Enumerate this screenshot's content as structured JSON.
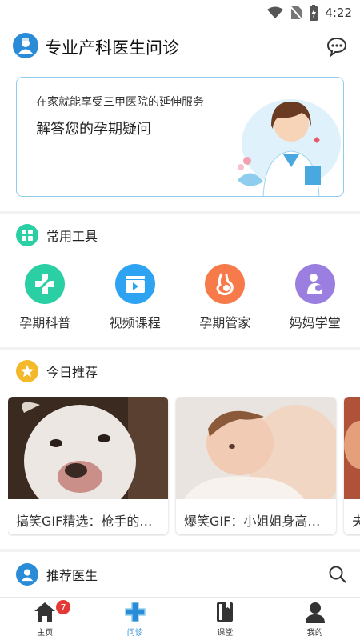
{
  "status_bar": {
    "time": "4:22"
  },
  "header": {
    "title": "专业产科医生问诊"
  },
  "banner": {
    "subtitle": "在家就能享受三甲医院的延伸服务",
    "headline": "解答您的孕期疑问"
  },
  "tools": {
    "section_title": "常用工具",
    "items": [
      {
        "label": "孕期科普",
        "icon": "cross-plus-icon",
        "color": "#2bcfa4"
      },
      {
        "label": "视频课程",
        "icon": "video-clapper-icon",
        "color": "#2ea3f2"
      },
      {
        "label": "孕期管家",
        "icon": "pregnant-belly-icon",
        "color": "#f77b4a"
      },
      {
        "label": "妈妈学堂",
        "icon": "mother-baby-icon",
        "color": "#9b7fe0"
      }
    ]
  },
  "recommend": {
    "section_title": "今日推荐",
    "cards": [
      {
        "title": "搞笑GIF精选：枪手的…"
      },
      {
        "title": "爆笑GIF：小姐姐身高…"
      },
      {
        "title": "夫"
      }
    ]
  },
  "doctors": {
    "section_title": "推荐医生"
  },
  "tabbar": {
    "items": [
      {
        "label": "主页",
        "badge": "7"
      },
      {
        "label": "问诊"
      },
      {
        "label": "课堂"
      },
      {
        "label": "我的"
      }
    ]
  },
  "colors": {
    "accent": "#2a8bd6",
    "badge": "#e53935",
    "banner_border": "#8fcdee"
  }
}
